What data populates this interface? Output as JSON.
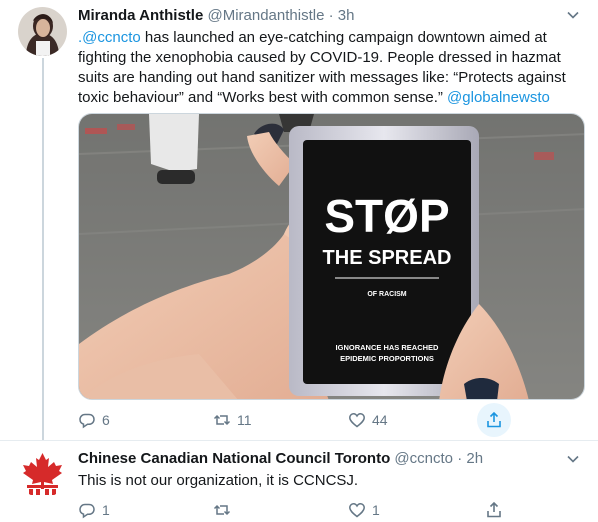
{
  "tweets": [
    {
      "name": "Miranda Anthistle",
      "handle": "@Mirandanthistle",
      "dot": "·",
      "time": "3h",
      "text_parts": {
        "mention": ".@ccncto",
        "main": " has launched an eye-catching campaign downtown aimed at fighting the xenophobia caused by COVID-19. People dressed in hazmat suits are handing out hand sanitizer with messages like: “Protects against toxic behaviour” and “Works best with common sense.” ",
        "link": "@globalnewsto"
      },
      "media": {
        "label_big_1": "ST",
        "label_big_2": "P",
        "label_sub": "THE SPREAD",
        "label_small": "OF RACISM",
        "label_bottom_1": "IGNORANCE HAS REACHED",
        "label_bottom_2": "EPIDEMIC PROPORTIONS"
      },
      "replies": "6",
      "retweets": "11",
      "likes": "44"
    },
    {
      "name": "Chinese Canadian National Council Toronto",
      "handle": "@ccncto",
      "dot": "·",
      "time": "2h",
      "text": "This is not our organization, it is CCNCSJ.",
      "replies": "1",
      "retweets": "",
      "likes": "1"
    }
  ],
  "colors": {
    "link": "#1b95e0",
    "secondary": "#657786",
    "logo_red": "#d62a2a"
  },
  "icons": [
    "chevron-down-icon",
    "reply-icon",
    "retweet-icon",
    "like-icon",
    "share-icon",
    "maple-leaf-logo"
  ]
}
